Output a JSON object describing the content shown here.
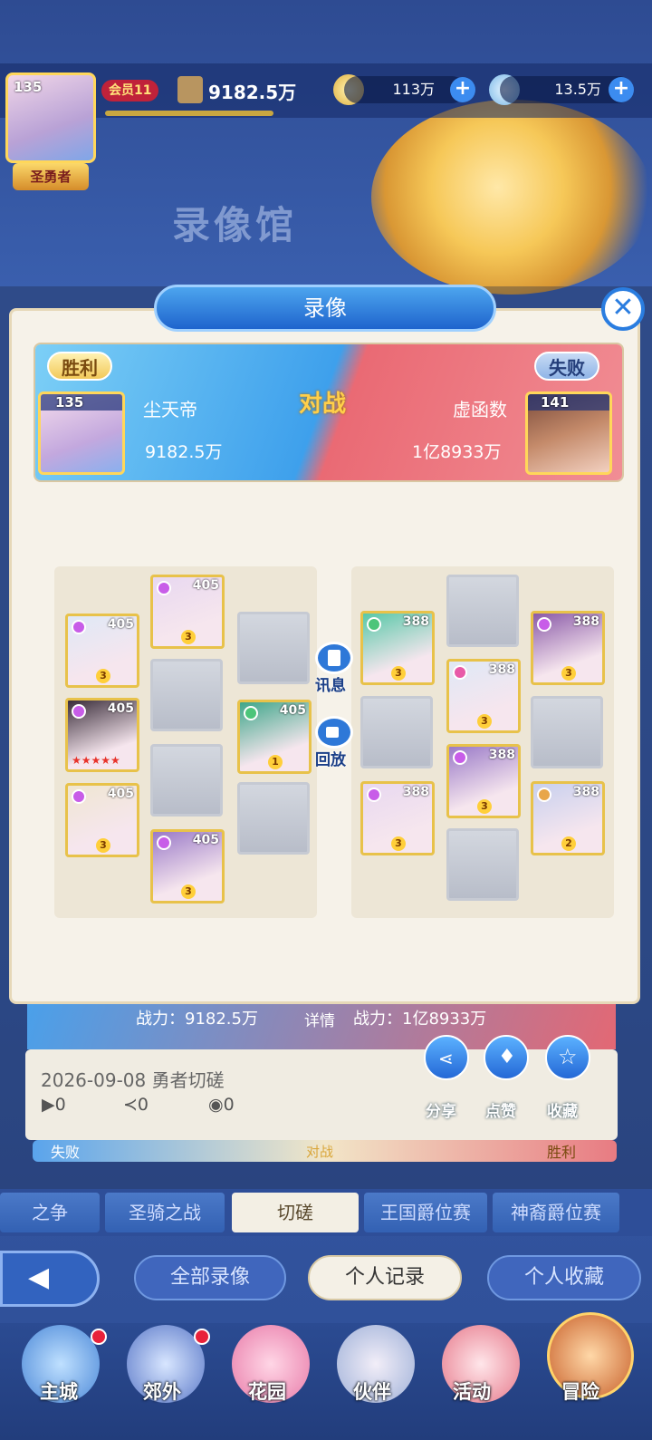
{
  "player": {
    "level": "135",
    "vip": "会员11",
    "power": "9182.5万",
    "title": "圣勇者"
  },
  "resources": {
    "gold": "113万",
    "gems": "13.5万"
  },
  "hall_title": "录像馆",
  "modal": {
    "title": "录像",
    "result_left": "胜利",
    "result_right": "失败",
    "vs": "对战",
    "left": {
      "level": "135",
      "name": "尘天帝",
      "power": "9182.5万"
    },
    "right": {
      "level": "141",
      "name": "虚函数",
      "power": "1亿8933万"
    },
    "info_label": "讯息",
    "replay_label": "回放",
    "left_heroes": [
      {
        "level": "405",
        "star": "3",
        "color": "#e8d8f0"
      },
      {
        "level": "405",
        "star": "3",
        "color": "#dfe8f6"
      },
      {
        "level": "405",
        "star": "",
        "color": "#3a2d3a"
      },
      {
        "level": "405",
        "star": "1",
        "color": "#3fa68a"
      },
      {
        "level": "405",
        "star": "3",
        "color": "#efe6d2"
      },
      {
        "level": "405",
        "star": "3",
        "color": "#9a7ac8"
      }
    ],
    "right_heroes": [
      {
        "level": "388",
        "star": "3",
        "color": "#58c8a8"
      },
      {
        "level": "388",
        "star": "3",
        "color": "#8a5aa8"
      },
      {
        "level": "388",
        "star": "3",
        "color": "#dfe8f6"
      },
      {
        "level": "388",
        "star": "3",
        "color": "#9a7ac8"
      },
      {
        "level": "388",
        "star": "3",
        "color": "#e8d8f0"
      },
      {
        "level": "388",
        "star": "2",
        "color": "#c8d0ee"
      }
    ]
  },
  "record": {
    "left_power": "战力：9182.5万",
    "detail": "详情",
    "right_power": "战力：1亿8933万",
    "date": "2026-09-08",
    "mode": "勇者切磋",
    "plays": "0",
    "shares": "0",
    "likes": "0",
    "share_label": "分享",
    "like_label": "点赞",
    "fav_label": "收藏",
    "next_left": "失败",
    "next_mid": "对战",
    "next_right": "胜利"
  },
  "tabs": [
    "之争",
    "圣骑之战",
    "切磋",
    "王国爵位赛",
    "神裔爵位赛"
  ],
  "filters": [
    "全部录像",
    "个人记录",
    "个人收藏"
  ],
  "nav": [
    "主城",
    "郊外",
    "花园",
    "伙伴",
    "活动",
    "冒险"
  ]
}
